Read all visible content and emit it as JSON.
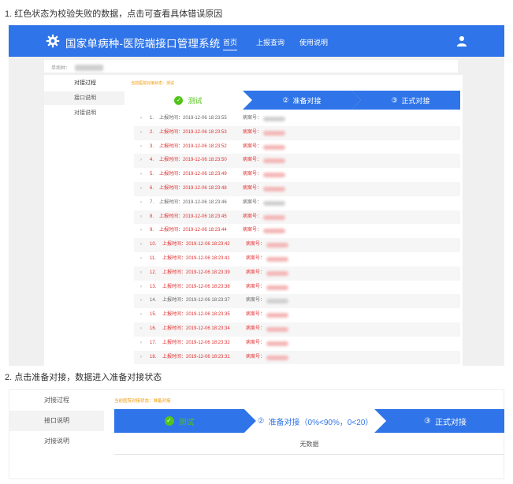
{
  "captions": {
    "one": "1. 红色状态为校验失败的数据，点击可查看具体错误原因",
    "two": "2. 点击准备对接，数据进入准备对接状态"
  },
  "app": {
    "title": "国家单病种-医院端接口管理系统",
    "nav": [
      "首页",
      "上报查询",
      "使用说明"
    ],
    "breadcrumb_label": "单病种："
  },
  "sidebar": {
    "items": [
      "对接过程",
      "接口说明",
      "对接说明"
    ]
  },
  "status_text_1": "当前医院对接状态：测试",
  "status_text_2": "当前医院对接状态：准备对接",
  "steps_1": [
    {
      "label": "测试",
      "marker": "check"
    },
    {
      "label": "准备对接",
      "marker": "②"
    },
    {
      "label": "正式对接",
      "marker": "③"
    }
  ],
  "steps_2": [
    {
      "label": "测试",
      "marker": "check"
    },
    {
      "label": "准备对接（0%<90%，0<20）",
      "marker": "②"
    },
    {
      "label": "正式对接",
      "marker": "③"
    }
  ],
  "records": {
    "time_label": "上报时间：",
    "case_label": "病案号：",
    "rows": [
      {
        "index": "1.",
        "time": "2019-12-06 18:23:55",
        "status": "ok"
      },
      {
        "index": "2.",
        "time": "2019-12-06 18:23:53",
        "status": "fail"
      },
      {
        "index": "3.",
        "time": "2019-12-06 18:23:52",
        "status": "fail"
      },
      {
        "index": "4.",
        "time": "2019-12-06 18:23:50",
        "status": "fail"
      },
      {
        "index": "5.",
        "time": "2019-12-06 18:23:49",
        "status": "fail"
      },
      {
        "index": "6.",
        "time": "2019-12-06 18:23:48",
        "status": "fail"
      },
      {
        "index": "7.",
        "time": "2019-12-06 18:23:46",
        "status": "ok"
      },
      {
        "index": "8.",
        "time": "2019-12-06 18:23:45",
        "status": "fail"
      },
      {
        "index": "9.",
        "time": "2019-12-06 18:23:44",
        "status": "fail"
      },
      {
        "index": "10.",
        "time": "2019-12-06 18:23:42",
        "status": "fail"
      },
      {
        "index": "11.",
        "time": "2019-12-06 18:23:41",
        "status": "fail"
      },
      {
        "index": "12.",
        "time": "2019-12-06 18:23:39",
        "status": "fail"
      },
      {
        "index": "13.",
        "time": "2019-12-06 18:23:38",
        "status": "fail"
      },
      {
        "index": "14.",
        "time": "2019-12-06 18:23:37",
        "status": "ok"
      },
      {
        "index": "15.",
        "time": "2019-12-06 18:23:35",
        "status": "fail"
      },
      {
        "index": "16.",
        "time": "2019-12-06 18:23:34",
        "status": "fail"
      },
      {
        "index": "17.",
        "time": "2019-12-06 18:23:32",
        "status": "fail"
      },
      {
        "index": "18.",
        "time": "2019-12-06 18:23:31",
        "status": "fail"
      }
    ]
  },
  "empty_text": "无数据",
  "colors": {
    "primary": "#2f74e8",
    "fail": "#e03030",
    "ok": "#666666",
    "warning": "#f39800",
    "success": "#52c41a"
  },
  "icons": {
    "logo": "gear-icon",
    "user": "user-icon",
    "row_expand": "chevron-right-icon"
  }
}
